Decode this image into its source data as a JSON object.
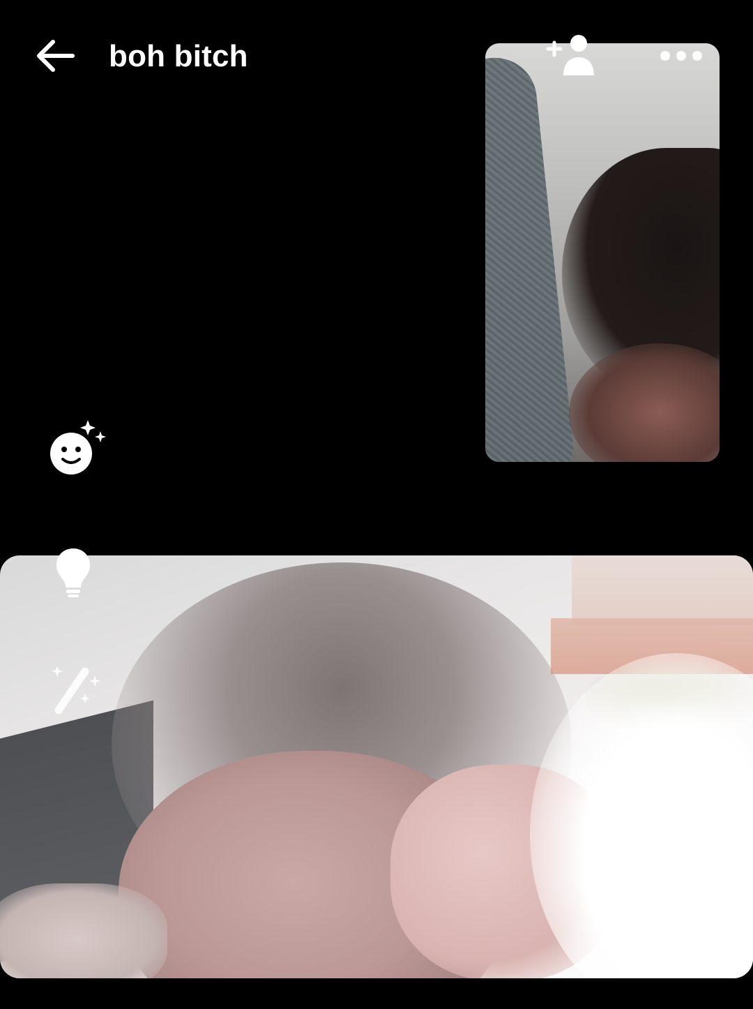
{
  "header": {
    "title": "boh bitch",
    "back_icon": "arrow-left-icon",
    "add_person_icon": "add-person-icon",
    "more_icon": "more-horizontal-icon"
  },
  "video": {
    "remote_tile": "remote-participant-video",
    "local_tile": "self-camera-video"
  },
  "side_tools": [
    {
      "icon": "face-effects-icon"
    },
    {
      "icon": "lightbulb-icon"
    },
    {
      "icon": "magic-wand-icon"
    }
  ],
  "colors": {
    "background": "#000000",
    "foreground": "#ffffff"
  }
}
